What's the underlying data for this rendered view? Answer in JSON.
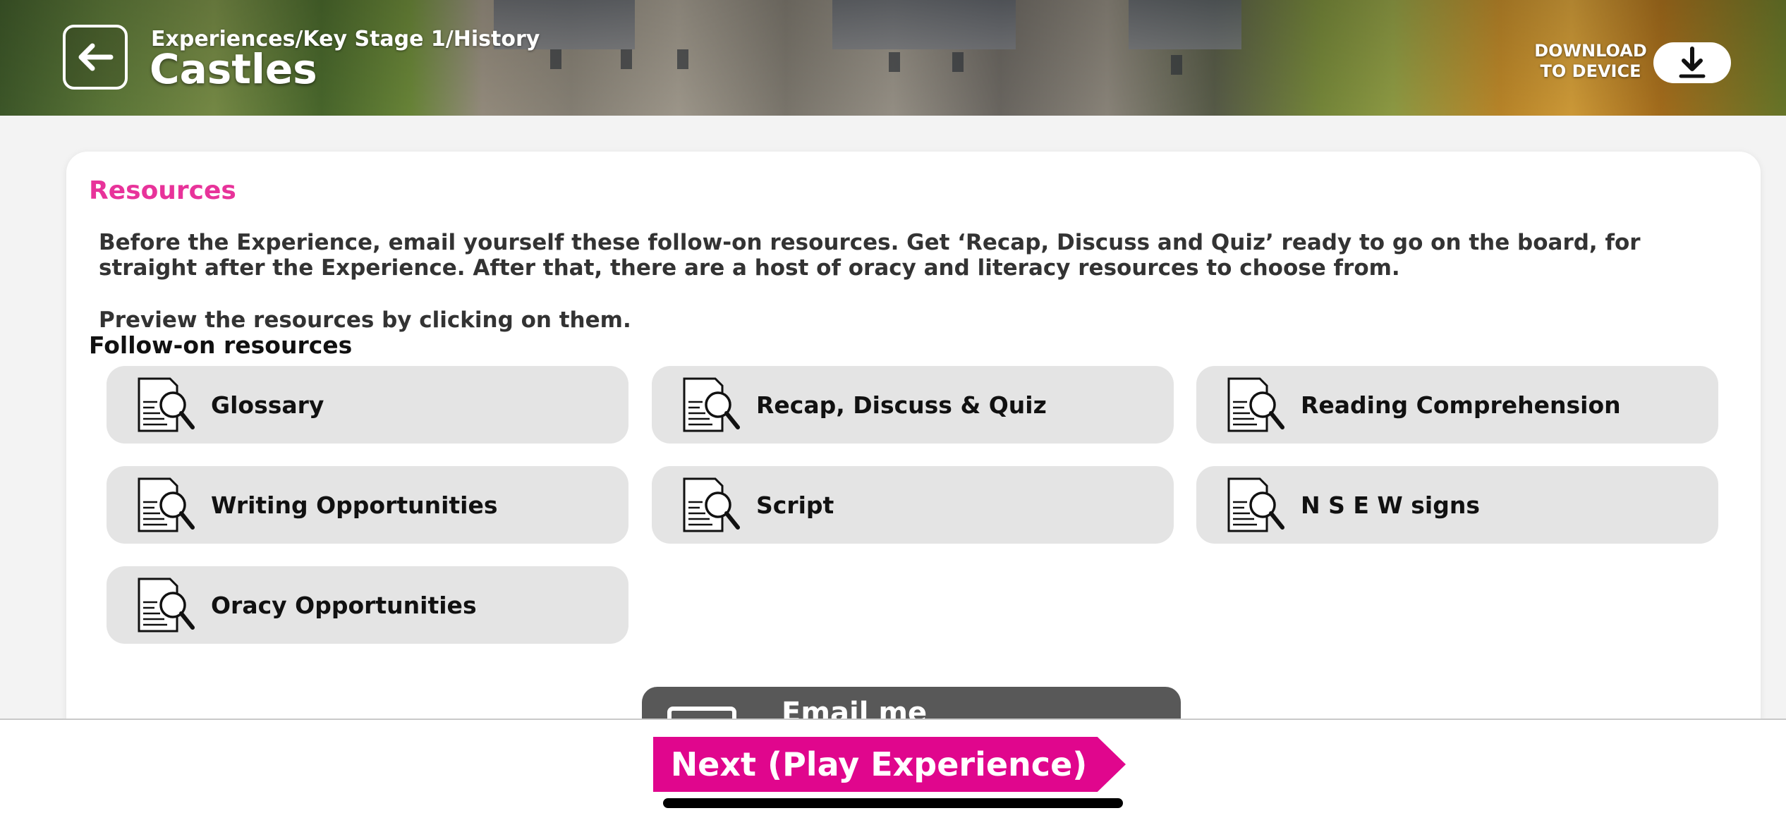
{
  "header": {
    "breadcrumb": "Experiences/Key Stage 1/History",
    "title": "Castles",
    "download_label_line1": "DOWNLOAD",
    "download_label_line2": "TO DEVICE"
  },
  "resources": {
    "title": "Resources",
    "intro": "Before the Experience, email yourself these follow-on resources. Get ‘Recap, Discuss and Quiz’ ready to go on the board, for straight after the Experience. After that, there are a host of oracy and literacy resources to choose from.",
    "preview": "Preview the resources by clicking on them.",
    "subheading": "Follow-on resources",
    "items": [
      {
        "label": "Glossary",
        "icon": "document-search-icon"
      },
      {
        "label": "Recap, Discuss & Quiz",
        "icon": "document-search-icon"
      },
      {
        "label": "Reading Comprehension",
        "icon": "document-search-icon"
      },
      {
        "label": "Writing Opportunities",
        "icon": "document-search-icon"
      },
      {
        "label": "Script",
        "icon": "document-search-icon"
      },
      {
        "label": "N S E W signs",
        "icon": "document-search-icon"
      },
      {
        "label": "Oracy Opportunities",
        "icon": "document-search-icon"
      }
    ]
  },
  "email": {
    "label": "Email me",
    "icon": "email-icon"
  },
  "footer": {
    "next_label": "Next (Play Experience)"
  },
  "colors": {
    "accent": "#e0068d",
    "title_pink": "#e8339a",
    "tile_bg": "#e4e4e4"
  }
}
